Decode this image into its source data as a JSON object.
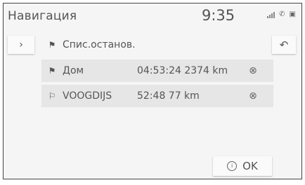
{
  "header": {
    "title": "Навигация",
    "time": "9:35",
    "icons": {
      "signal": "signal-bars-icon",
      "phone": "phone-status-icon",
      "battery": "battery-icon"
    }
  },
  "list": {
    "header_label": "Спис.останов.",
    "side_icon": "chevron-right-icon",
    "back_icon": "back-return-icon",
    "items": [
      {
        "icon": "destination-flag-icon",
        "name": "Дом",
        "info": "04:53:24 2374 km"
      },
      {
        "icon": "waypoint-flag-icon",
        "name": "VOOGDIJS",
        "info": "52:48 77 km"
      }
    ]
  },
  "footer": {
    "ok_label": "OK"
  }
}
